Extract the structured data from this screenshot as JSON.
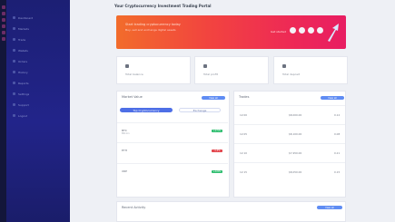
{
  "sidebar": {
    "items": [
      {
        "label": "Dashboard"
      },
      {
        "label": "Markets"
      },
      {
        "label": "Trade"
      },
      {
        "label": "Wallets"
      },
      {
        "label": "Orders"
      },
      {
        "label": "History"
      },
      {
        "label": "Reports"
      },
      {
        "label": "Settings"
      },
      {
        "label": "Support"
      },
      {
        "label": "Logout"
      }
    ]
  },
  "header": {
    "title": "Your Cryptocurrency Investment Trading Portal"
  },
  "banner": {
    "title": "Start trading cryptocurrency today",
    "subtitle": "Buy, sell and exchange digital assets",
    "link": "Get started"
  },
  "stats": [
    {
      "label": "Total balance"
    },
    {
      "label": "Total profit"
    },
    {
      "label": "Total deposit"
    }
  ],
  "market": {
    "title": "Market Value",
    "action": "View all",
    "tabs": [
      "Top Cryptocurrency",
      "Exchange"
    ],
    "rows": [
      {
        "name": "BTC",
        "sub": "Bitcoin",
        "change": "+2.5%"
      },
      {
        "name": "ETH",
        "sub": "",
        "change": "-1.4%"
      },
      {
        "name": "XRP",
        "sub": "",
        "change": "+0.8%"
      }
    ]
  },
  "trades": {
    "title": "Trades",
    "action": "View all",
    "rows": [
      {
        "time": "12:00",
        "price": "$8,000.00",
        "amount": "0.12"
      },
      {
        "time": "12:05",
        "price": "$8,100.00",
        "amount": "0.08"
      },
      {
        "time": "12:10",
        "price": "$7,950.00",
        "amount": "0.21"
      },
      {
        "time": "12:15",
        "price": "$8,050.00",
        "amount": "0.15"
      }
    ]
  },
  "bottom": {
    "title": "Recent Activity",
    "action": "View all"
  },
  "colors": {
    "sidebar": "#1f2280",
    "accent": "#4e6fe6",
    "positive": "#2dbd6e",
    "negative": "#e2434a"
  }
}
